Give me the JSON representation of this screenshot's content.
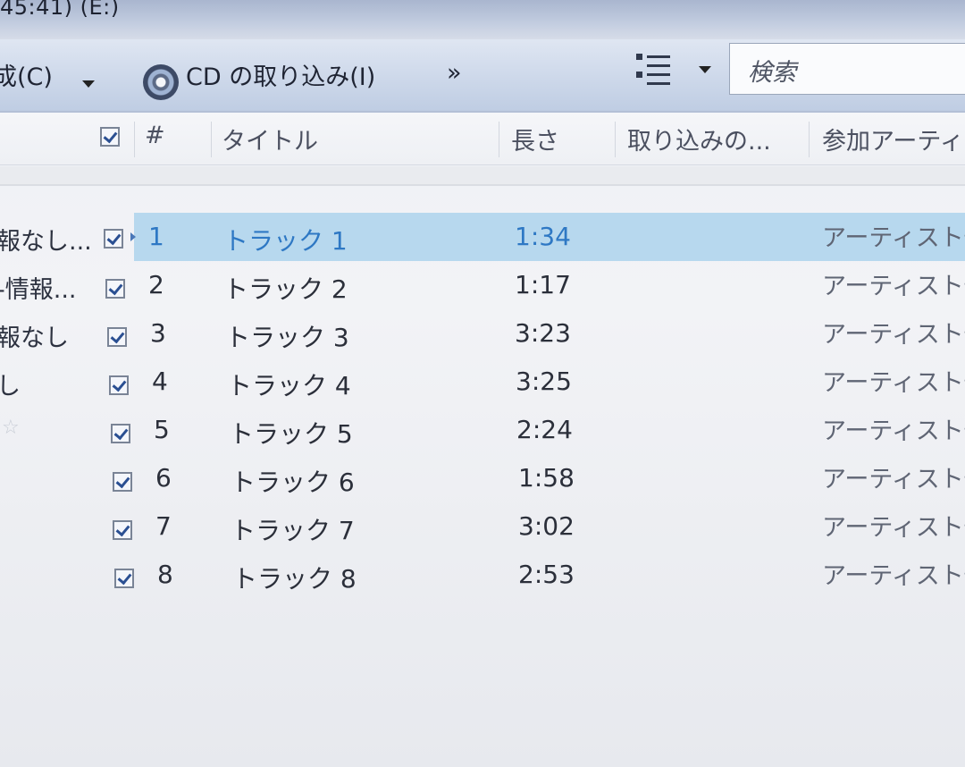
{
  "window": {
    "title_fragment": "45:41) (E:)"
  },
  "toolbar": {
    "left_menu_label": "成(C)",
    "rip_cd_label": "CD の取り込み(I)",
    "overflow_label": "»",
    "search_placeholder": "検索"
  },
  "columns": {
    "number": "#",
    "title": "タイトル",
    "length": "長さ",
    "rip_status": "取り込みの...",
    "contributing_artist": "参加アーティス"
  },
  "tracks": [
    {
      "left": "報なし...",
      "num": "1",
      "title": "トラック 1",
      "length": "1:34",
      "artist": "アーティスト情",
      "selected": true
    },
    {
      "left": "-情報...",
      "num": "2",
      "title": "トラック 2",
      "length": "1:17",
      "artist": "アーティスト情"
    },
    {
      "left": "報なし",
      "num": "3",
      "title": "トラック 3",
      "length": "3:23",
      "artist": "アーティスト情"
    },
    {
      "left": "し",
      "num": "4",
      "title": "トラック 4",
      "length": "3:25",
      "artist": "アーティスト情"
    },
    {
      "left": "",
      "num": "5",
      "title": "トラック 5",
      "length": "2:24",
      "artist": "アーティスト情"
    },
    {
      "left": "",
      "num": "6",
      "title": "トラック 6",
      "length": "1:58",
      "artist": "アーティスト情"
    },
    {
      "left": "",
      "num": "7",
      "title": "トラック 7",
      "length": "3:02",
      "artist": "アーティスト情"
    },
    {
      "left": "",
      "num": "8",
      "title": "トラック 8",
      "length": "2:53",
      "artist": "アーティスト情"
    }
  ],
  "colors": {
    "selection": "#b7d8ee",
    "selected_text": "#2e78c4",
    "toolbar": "#cdd8ea"
  }
}
